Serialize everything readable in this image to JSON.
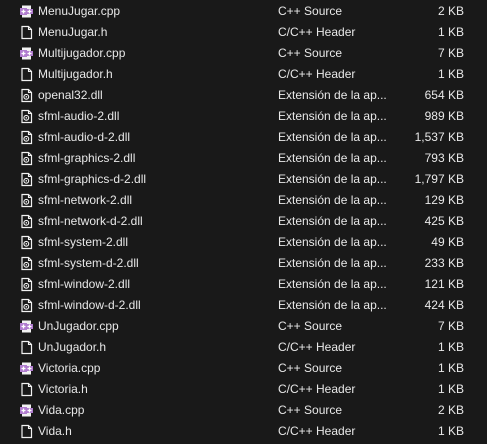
{
  "files": [
    {
      "name": "MenuJugar.cpp",
      "type": "C++ Source",
      "size": "2 KB",
      "icon": "cpp-file-icon"
    },
    {
      "name": "MenuJugar.h",
      "type": "C/C++ Header",
      "size": "1 KB",
      "icon": "header-file-icon"
    },
    {
      "name": "Multijugador.cpp",
      "type": "C++ Source",
      "size": "7 KB",
      "icon": "cpp-file-icon"
    },
    {
      "name": "Multijugador.h",
      "type": "C/C++ Header",
      "size": "1 KB",
      "icon": "header-file-icon"
    },
    {
      "name": "openal32.dll",
      "type": "Extensión de la ap...",
      "size": "654 KB",
      "icon": "dll-file-icon"
    },
    {
      "name": "sfml-audio-2.dll",
      "type": "Extensión de la ap...",
      "size": "989 KB",
      "icon": "dll-file-icon"
    },
    {
      "name": "sfml-audio-d-2.dll",
      "type": "Extensión de la ap...",
      "size": "1,537 KB",
      "icon": "dll-file-icon"
    },
    {
      "name": "sfml-graphics-2.dll",
      "type": "Extensión de la ap...",
      "size": "793 KB",
      "icon": "dll-file-icon"
    },
    {
      "name": "sfml-graphics-d-2.dll",
      "type": "Extensión de la ap...",
      "size": "1,797 KB",
      "icon": "dll-file-icon"
    },
    {
      "name": "sfml-network-2.dll",
      "type": "Extensión de la ap...",
      "size": "129 KB",
      "icon": "dll-file-icon"
    },
    {
      "name": "sfml-network-d-2.dll",
      "type": "Extensión de la ap...",
      "size": "425 KB",
      "icon": "dll-file-icon"
    },
    {
      "name": "sfml-system-2.dll",
      "type": "Extensión de la ap...",
      "size": "49 KB",
      "icon": "dll-file-icon"
    },
    {
      "name": "sfml-system-d-2.dll",
      "type": "Extensión de la ap...",
      "size": "233 KB",
      "icon": "dll-file-icon"
    },
    {
      "name": "sfml-window-2.dll",
      "type": "Extensión de la ap...",
      "size": "121 KB",
      "icon": "dll-file-icon"
    },
    {
      "name": "sfml-window-d-2.dll",
      "type": "Extensión de la ap...",
      "size": "424 KB",
      "icon": "dll-file-icon"
    },
    {
      "name": "UnJugador.cpp",
      "type": "C++ Source",
      "size": "7 KB",
      "icon": "cpp-file-icon"
    },
    {
      "name": "UnJugador.h",
      "type": "C/C++ Header",
      "size": "1 KB",
      "icon": "header-file-icon"
    },
    {
      "name": "Victoria.cpp",
      "type": "C++ Source",
      "size": "1 KB",
      "icon": "cpp-file-icon"
    },
    {
      "name": "Victoria.h",
      "type": "C/C++ Header",
      "size": "1 KB",
      "icon": "header-file-icon"
    },
    {
      "name": "Vida.cpp",
      "type": "C++ Source",
      "size": "2 KB",
      "icon": "cpp-file-icon"
    },
    {
      "name": "Vida.h",
      "type": "C/C++ Header",
      "size": "1 KB",
      "icon": "header-file-icon"
    }
  ],
  "colors": {
    "background": "#191919",
    "text": "#e8e8e8",
    "cpp_icon": "#b07ccf",
    "page_icon": "#f2f2f2"
  }
}
